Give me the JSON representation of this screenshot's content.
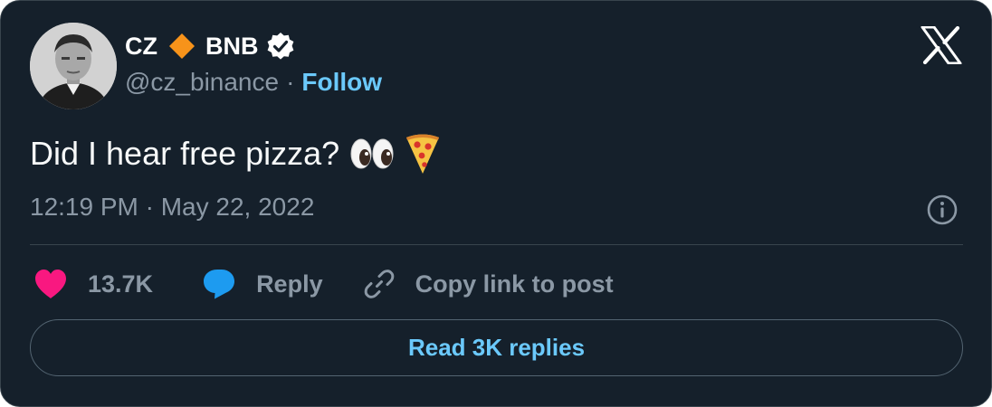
{
  "author": {
    "name_prefix": "CZ",
    "name_suffix": "BNB",
    "handle": "@cz_binance",
    "separator": "·",
    "follow_label": "Follow",
    "icons": {
      "diamond": "orange-diamond-icon",
      "verified": "verified-badge-icon",
      "platform": "x-logo-icon"
    }
  },
  "tweet": {
    "text": "Did I hear free pizza?",
    "emojis": [
      "eyes-emoji",
      "pizza-emoji"
    ],
    "timestamp": "12:19 PM · May 22, 2022"
  },
  "actions": {
    "like_count": "13.7K",
    "reply_label": "Reply",
    "copy_label": "Copy link to post"
  },
  "read_replies_label": "Read 3K replies",
  "colors": {
    "background": "#15202b",
    "accent": "#6bc9fb",
    "like": "#f91880",
    "reply": "#1d9bf0",
    "muted": "#8b98a5",
    "diamond": "#f7931a"
  }
}
